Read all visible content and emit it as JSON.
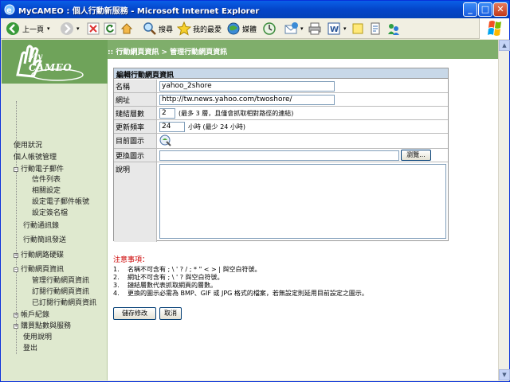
{
  "window": {
    "title": "MyCAMEO : 個人行動新服務 - Microsoft Internet Explorer",
    "minimize": "_",
    "maximize": "□",
    "close": "✕"
  },
  "toolbar": {
    "back_label": "上一頁",
    "search_label": "搜尋",
    "favorites_label": "我的最愛",
    "media_label": "媒體"
  },
  "logo": {
    "my": "My",
    "name": "CAMEO"
  },
  "breadcrumb": ":: 行動網頁資訊 > 管理行動網頁資訊",
  "sidebar": {
    "items": [
      {
        "label": "使用狀況",
        "expander": ""
      },
      {
        "label": "個人帳號管理",
        "expander": ""
      },
      {
        "label": "行動電子郵件",
        "expander": "−"
      },
      {
        "label": "信件列表",
        "expander": ""
      },
      {
        "label": "相關設定",
        "expander": ""
      },
      {
        "label": "設定電子郵件帳號",
        "expander": ""
      },
      {
        "label": "設定簽名檔",
        "expander": ""
      },
      {
        "label": "行動通訊錄",
        "expander": ""
      },
      {
        "label": "行動簡訊發送",
        "expander": ""
      },
      {
        "label": "行動網路硬碟",
        "expander": "+"
      },
      {
        "label": "行動網頁資訊",
        "expander": "−"
      },
      {
        "label": "管理行動網頁資訊",
        "expander": ""
      },
      {
        "label": "訂閱行動網頁資訊",
        "expander": ""
      },
      {
        "label": "已訂閱行動網頁資訊",
        "expander": ""
      },
      {
        "label": "帳戶紀錄",
        "expander": "+"
      },
      {
        "label": "購買點數與服務",
        "expander": "+"
      },
      {
        "label": "使用說明",
        "expander": ""
      },
      {
        "label": "登出",
        "expander": ""
      }
    ]
  },
  "form": {
    "title": "編輯行動網頁資訊",
    "name_label": "名稱",
    "name_value": "yahoo_2shore",
    "url_label": "網址",
    "url_value": "http://tw.news.yahoo.com/twoshore/",
    "depth_label": "鏈結層數",
    "depth_value": "2",
    "depth_hint": "(最多 3 層，且僅會抓取相對路徑的連結)",
    "freq_label": "更新頻率",
    "freq_value": "24",
    "freq_hint": "小時 (最少 24 小時)",
    "icon_label": "目前圖示",
    "change_icon_label": "更換圖示",
    "browse_label": "瀏覽...",
    "desc_label": "說明"
  },
  "notes": {
    "title": "注意事項：",
    "items": [
      {
        "n": "1.",
        "text": "名稱不可含有 ; \\ ' ? / ; * \" < > | 與空白符號。"
      },
      {
        "n": "2.",
        "text": "網址不可含有 ; \\ ' ? 與空白符號。"
      },
      {
        "n": "3.",
        "text": "鏈結層數代表抓取網頁的層數。"
      },
      {
        "n": "4.",
        "text": "更換的圖示必需為 BMP、GIF 或 JPG 格式的檔案，若無設定則延用目前設定之圖示。"
      }
    ]
  },
  "buttons": {
    "save": "儲存修改",
    "cancel": "取消"
  }
}
